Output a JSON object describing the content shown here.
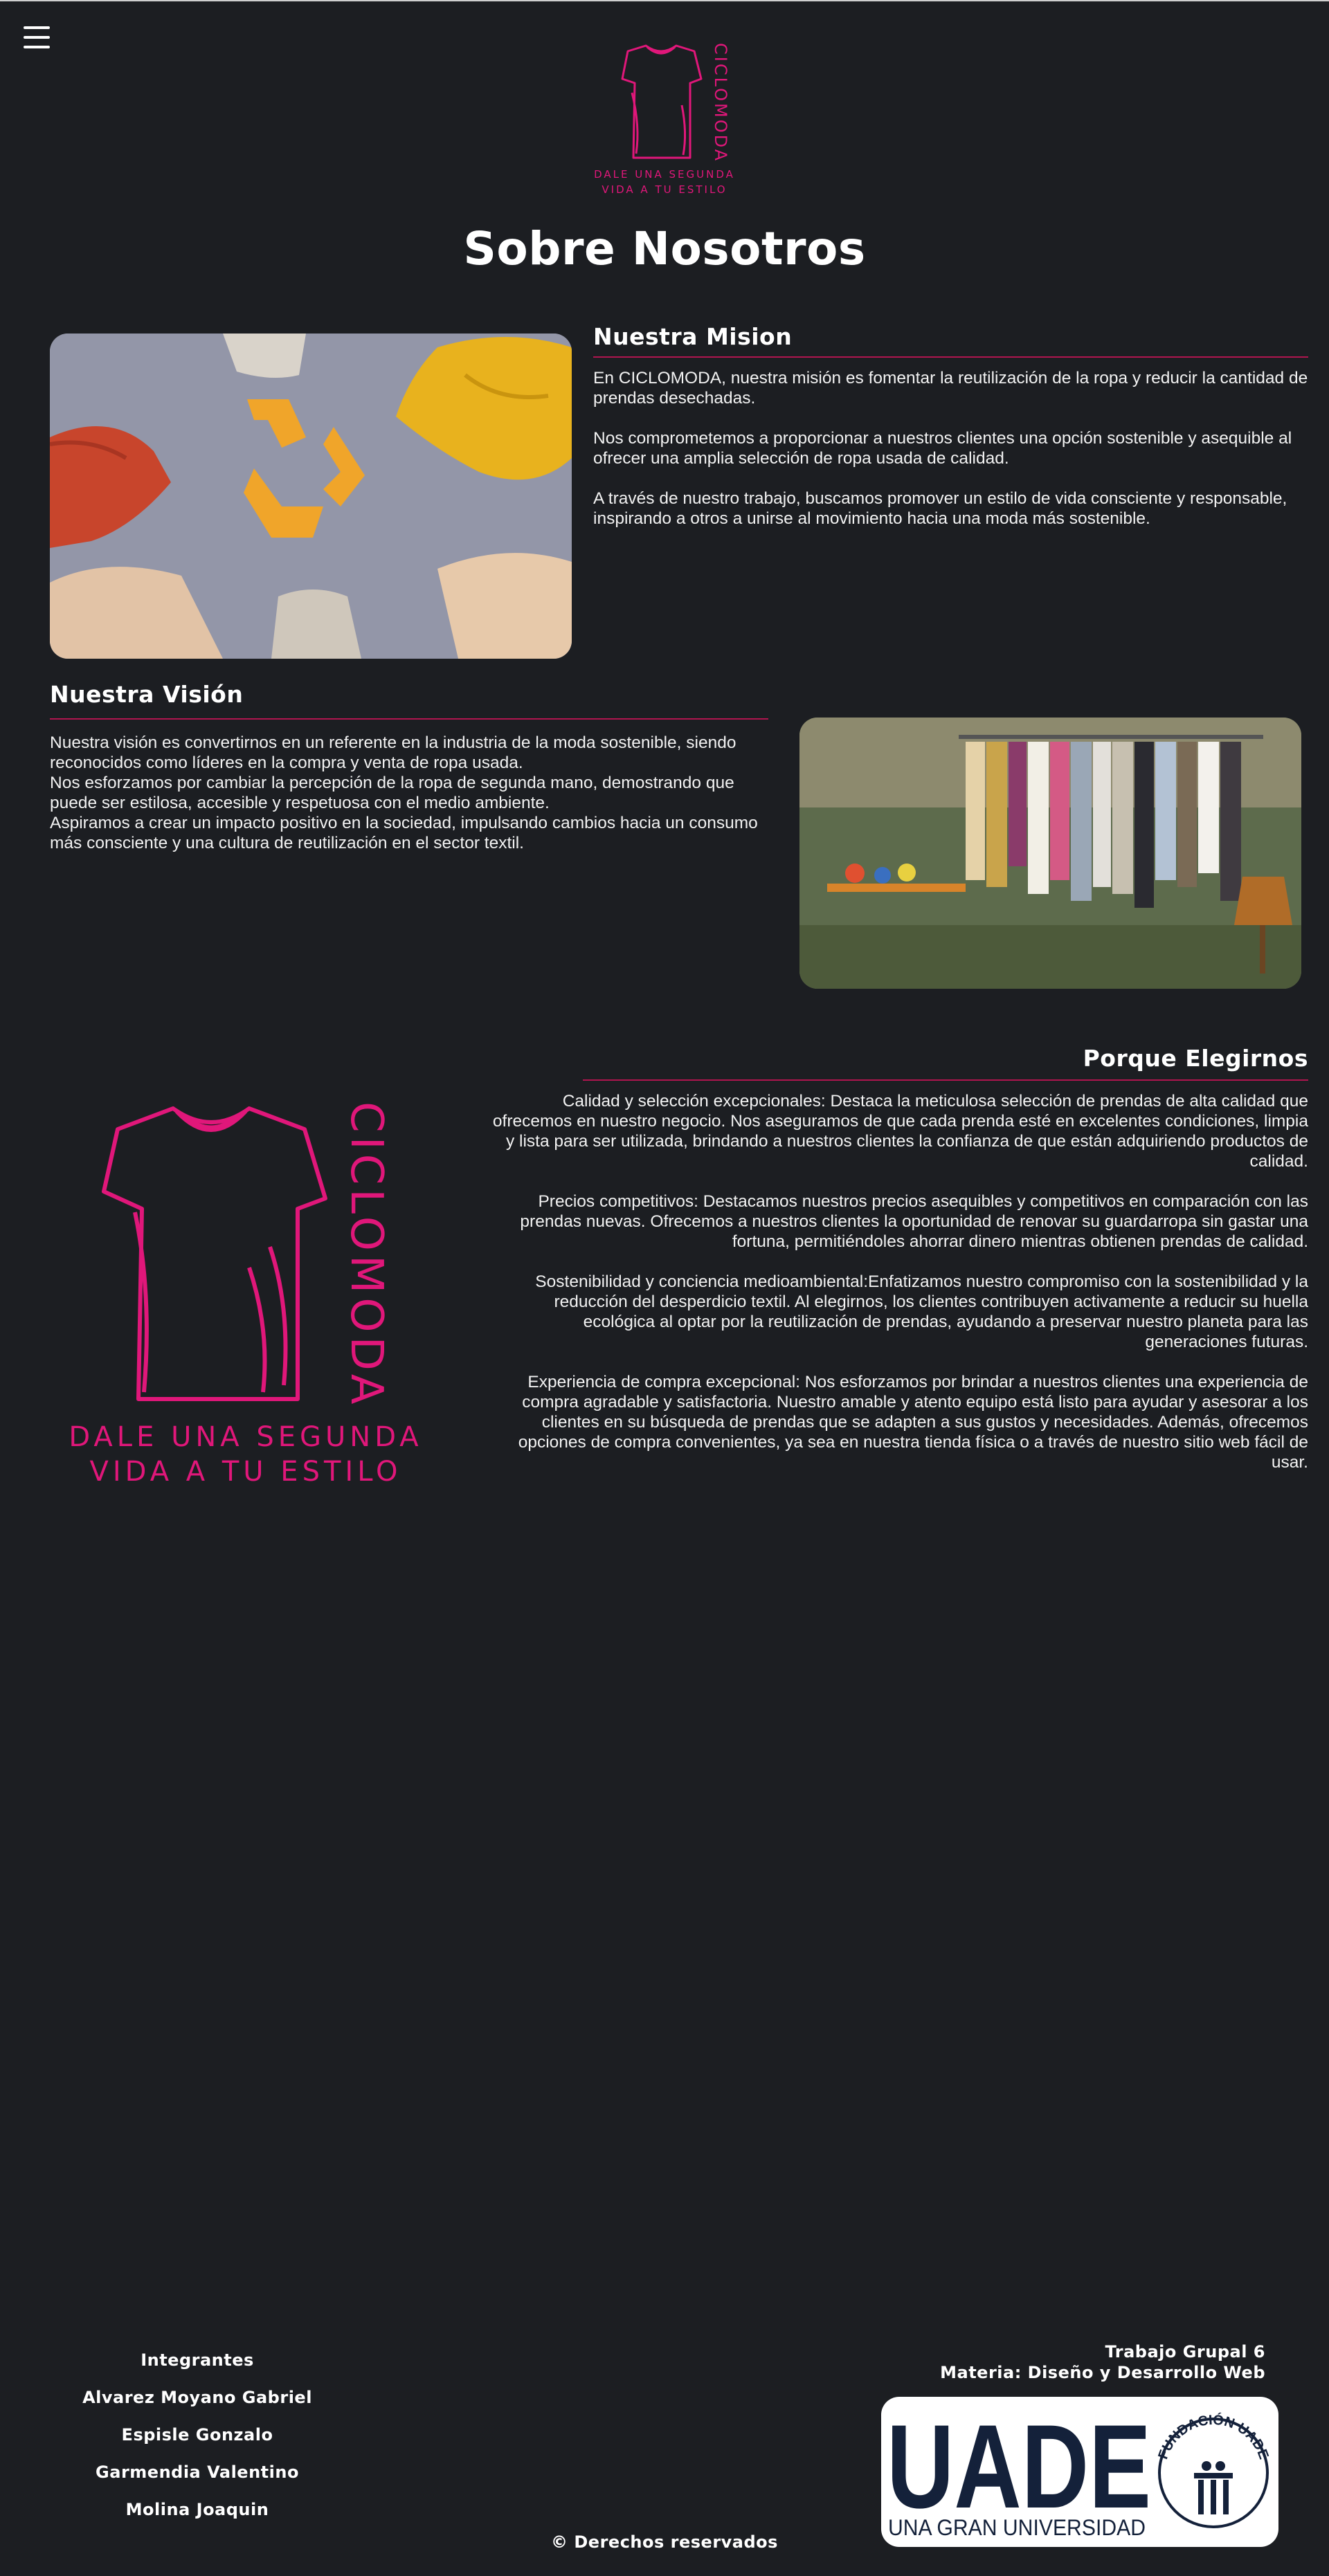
{
  "header": {
    "menu_icon": "hamburger-icon",
    "logo": {
      "brand": "CICLOMODA",
      "tagline_line1": "DALE UNA SEGUNDA",
      "tagline_line2": "VIDA A TU ESTILO",
      "icon": "tshirt-icon",
      "color": "#e0177a"
    }
  },
  "page_title": "Sobre Nosotros",
  "mission": {
    "heading": "Nuestra Mision",
    "image_alt": "recycle-sweaters-photo",
    "paragraphs": [
      "En CICLOMODA, nuestra misión es fomentar la reutilización de la ropa y reducir la cantidad de prendas desechadas.",
      "Nos comprometemos a proporcionar a nuestros clientes una opción sostenible y asequible al ofrecer una amplia selección de ropa usada de calidad.",
      "A través de nuestro trabajo, buscamos promover un estilo de vida consciente y responsable, inspirando a otros a unirse al movimiento hacia una moda más sostenible."
    ]
  },
  "vision": {
    "heading": "Nuestra Visión",
    "image_alt": "clothing-rack-photo",
    "lines": [
      "Nuestra visión es convertirnos en un referente en la industria de la moda sostenible, siendo reconocidos como líderes en la compra y venta de ropa usada.",
      "Nos esforzamos por cambiar la percepción de la ropa de segunda mano, demostrando que puede ser estilosa, accesible y respetuosa con el medio ambiente.",
      "Aspiramos a crear un impacto positivo en la sociedad, impulsando cambios hacia un consumo más consciente y una cultura de reutilización en el sector textil."
    ]
  },
  "why": {
    "heading": "Porque Elegirnos",
    "paragraphs": [
      "Calidad y selección excepcionales: Destaca la meticulosa selección de prendas de alta calidad que ofrecemos en nuestro negocio. Nos aseguramos de que cada prenda esté en excelentes condiciones, limpia y lista para ser utilizada, brindando a nuestros clientes la confianza de que están adquiriendo productos de calidad.",
      "Precios competitivos: Destacamos nuestros precios asequibles y competitivos en comparación con las prendas nuevas. Ofrecemos a nuestros clientes la oportunidad de renovar su guardarropa sin gastar una fortuna, permitiéndoles ahorrar dinero mientras obtienen prendas de calidad.",
      "Sostenibilidad y conciencia medioambiental:Enfatizamos nuestro compromiso con la sostenibilidad y la reducción del desperdicio textil. Al elegirnos, los clientes contribuyen activamente a reducir su huella ecológica al optar por la reutilización de prendas, ayudando a preservar nuestro planeta para las generaciones futuras.",
      "Experiencia de compra excepcional: Nos esforzamos por brindar a nuestros clientes una experiencia de compra agradable y satisfactoria. Nuestro amable y atento equipo está listo para ayudar y asesorar a los clientes en su búsqueda de prendas que se adapten a sus gustos y necesidades. Además, ofrecemos opciones de compra convenientes, ya sea en nuestra tienda física o a través de nuestro sitio web fácil de usar."
    ]
  },
  "footer": {
    "members_title": "Integrantes",
    "members": [
      "Alvarez Moyano Gabriel",
      "Espisle Gonzalo",
      "Garmendia Valentino",
      "Molina Joaquin"
    ],
    "project": "Trabajo Grupal 6",
    "subject": "Materia: Diseño y Desarrollo Web",
    "uade": {
      "name": "UADE",
      "slogan": "UNA GRAN UNIVERSIDAD",
      "foundation": "FUNDACIÓN UADE"
    },
    "copyright": "© Derechos reservados"
  }
}
